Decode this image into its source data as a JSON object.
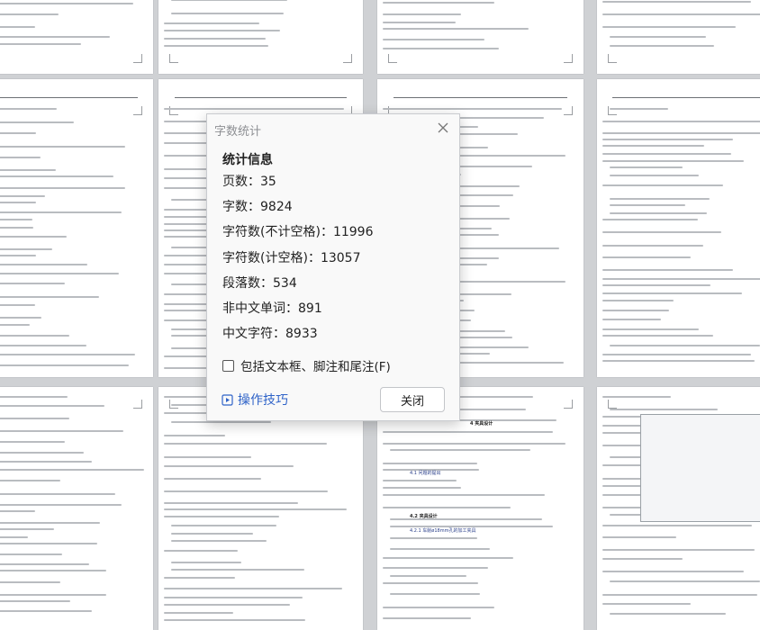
{
  "dialog": {
    "title": "字数统计",
    "section_title": "统计信息",
    "stats": [
      {
        "label": "页数",
        "value": "35"
      },
      {
        "label": "字数",
        "value": "9824"
      },
      {
        "label": "字符数(不计空格)",
        "value": "11996"
      },
      {
        "label": "字符数(计空格)",
        "value": "13057"
      },
      {
        "label": "段落数",
        "value": "534"
      },
      {
        "label": "非中文单词",
        "value": "891"
      },
      {
        "label": "中文字符",
        "value": "8933"
      }
    ],
    "include_textbox_label": "包括文本框、脚注和尾注(F)",
    "include_textbox_checked": false,
    "tips_label": "操作技巧",
    "close_label": "关闭"
  },
  "document": {
    "heading_design": "4 夹具设计",
    "heading_problem": "4.1 问题的提出",
    "heading_fixture": "4.2 夹具设计",
    "heading_fixture_sub": "4.2.1 车削ø18mm孔的加工夹具",
    "stat_sep": "："
  }
}
